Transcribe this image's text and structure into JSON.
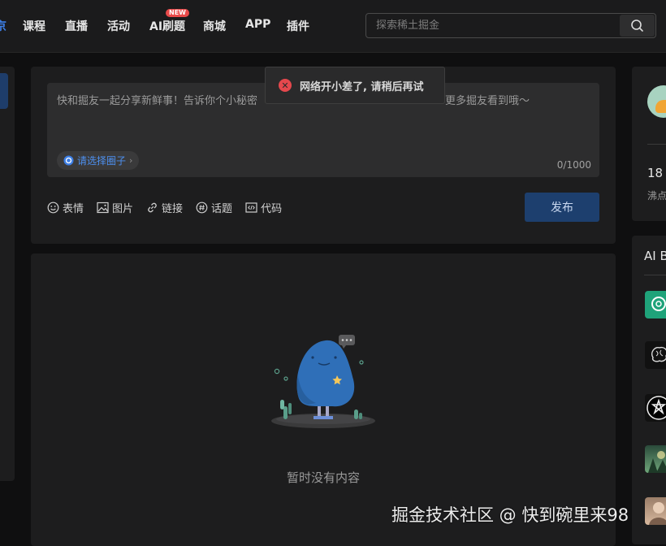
{
  "nav": {
    "items": [
      {
        "label": "课程"
      },
      {
        "label": "直播"
      },
      {
        "label": "活动"
      },
      {
        "label": "AI刷题"
      },
      {
        "label": "商城"
      },
      {
        "label": "APP"
      },
      {
        "label": "插件"
      }
    ],
    "partial_active_label": "京",
    "new_badge": "NEW",
    "search": {
      "placeholder": "探索稀土掘金"
    }
  },
  "composer": {
    "placeholder_start": "快和掘友一起分享新鲜事！告诉你个小秘密",
    "placeholder_end": "更多掘友看到哦～",
    "circle_pill": "请选择圈子",
    "counter": "0/1000",
    "tools": [
      {
        "label": "表情",
        "icon": "smile-icon"
      },
      {
        "label": "图片",
        "icon": "image-icon"
      },
      {
        "label": "链接",
        "icon": "link-icon"
      },
      {
        "label": "话题",
        "icon": "topic-icon"
      },
      {
        "label": "代码",
        "icon": "code-icon"
      }
    ],
    "publish_label": "发布"
  },
  "toast": {
    "message": "网络开小差了, 请稍后再试"
  },
  "feed": {
    "empty_text": "暂时没有内容"
  },
  "right": {
    "stat_number": "18",
    "stat_label": "沸点",
    "ai_title": "AI B"
  },
  "watermark": "掘金技术社区 @ 快到碗里来98",
  "colors": {
    "accent": "#3d7fe6",
    "error": "#e5484d",
    "publish": "#1d3f6e"
  }
}
